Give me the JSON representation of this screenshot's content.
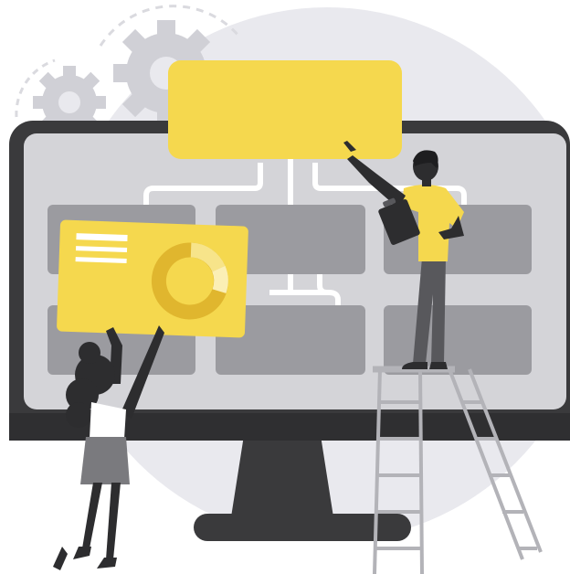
{
  "illustration": {
    "colors": {
      "accent_yellow": "#F5D84E",
      "yellow_dark": "#E0B62E",
      "monitor_frame": "#3A3A3C",
      "screen_bg": "#D4D4D8",
      "placeholder_block": "#9B9BA0",
      "background_circle": "#E9E9EE",
      "gear": "#D0D0D6",
      "connector_line": "#FFFFFF",
      "ladder": "#B3B3B8",
      "skin": "#2D2D2F",
      "shirt_yellow": "#F5D84E",
      "pants": "#58585C",
      "hair": "#2D2D2F",
      "woman_top": "#FFFFFF",
      "woman_skirt": "#7A7A7E"
    },
    "icons": [
      "gear-icon",
      "donut-chart-icon",
      "clipboard-icon"
    ]
  }
}
